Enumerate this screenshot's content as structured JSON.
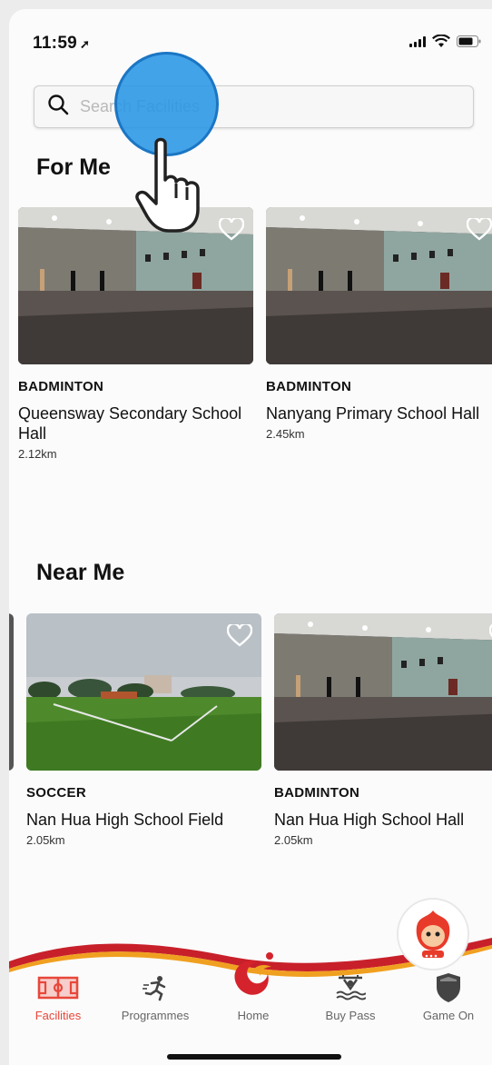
{
  "status_bar": {
    "time": "11:59"
  },
  "search": {
    "placeholder": "Search Facilities"
  },
  "sections": {
    "for_me": {
      "title": "For Me",
      "cards": [
        {
          "sport": "BADMINTON",
          "name": "Queensway Secondary School Hall",
          "distance": "2.12km"
        },
        {
          "sport": "BADMINTON",
          "name": "Nanyang Primary School Hall",
          "distance": "2.45km"
        }
      ]
    },
    "near_me": {
      "title": "Near Me",
      "cards": [
        {
          "sport": "SOCCER",
          "name": "Nan Hua High School Field",
          "distance": "2.05km"
        },
        {
          "sport": "BADMINTON",
          "name": "Nan Hua High School Hall",
          "distance": "2.05km"
        }
      ]
    }
  },
  "nav": {
    "items": [
      {
        "label": "Facilities",
        "icon": "facilities-icon",
        "active": true
      },
      {
        "label": "Programmes",
        "icon": "runner-icon",
        "active": false
      },
      {
        "label": "Home",
        "icon": "home-flame-icon",
        "active": false
      },
      {
        "label": "Buy Pass",
        "icon": "swimmer-icon",
        "active": false
      },
      {
        "label": "Game On",
        "icon": "shield-icon",
        "active": false
      }
    ]
  },
  "colors": {
    "accent": "#e8473a",
    "nav_wave": "#c8202a",
    "touch": "#2996e6"
  }
}
